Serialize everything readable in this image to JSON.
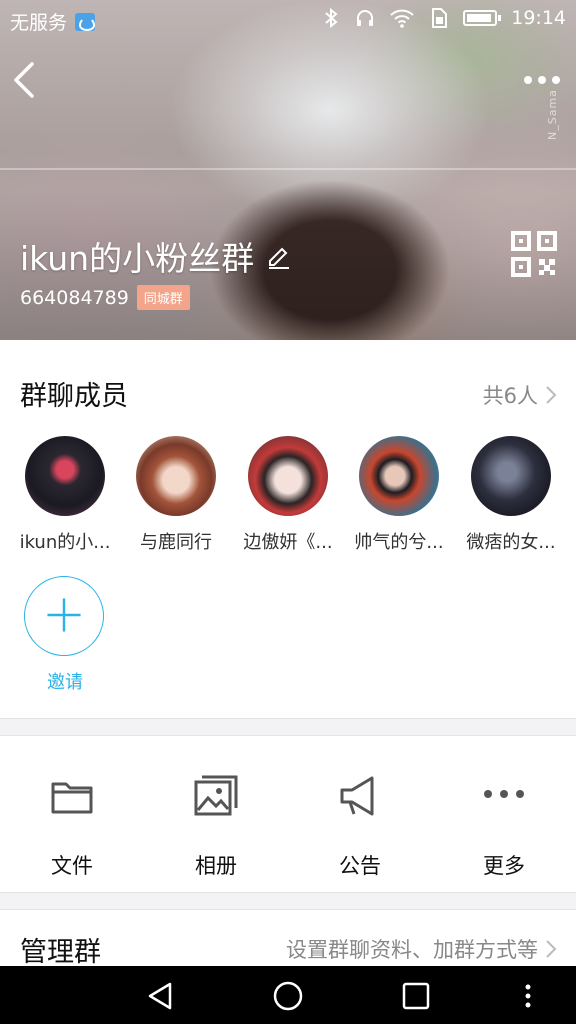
{
  "status_bar": {
    "carrier": "无服务",
    "time": "19:14",
    "icons": [
      "app-notification-icon",
      "bluetooth-icon",
      "headphones-icon",
      "wifi-icon",
      "sim-icon",
      "battery-icon"
    ]
  },
  "header": {
    "group_name": "ikun的小粉丝群",
    "group_id": "664084789",
    "badge": "同城群",
    "watermark": "N_Sama",
    "accent_color": "#2ab3e6"
  },
  "members": {
    "title": "群聊成员",
    "count_label": "共6人",
    "items": [
      {
        "name": "ikun的小...",
        "avatar_colors": [
          "#1a1a22",
          "#d8455c"
        ]
      },
      {
        "name": "与鹿同行",
        "avatar_colors": [
          "#e9cdb8",
          "#a2543a"
        ]
      },
      {
        "name": "边傲妍《...",
        "avatar_colors": [
          "#2a2424",
          "#f4e1dc"
        ]
      },
      {
        "name": "帅气的兮...",
        "avatar_colors": [
          "#3b6f8b",
          "#c7472f"
        ]
      },
      {
        "name": "微痞的女...",
        "avatar_colors": [
          "#2d2f3e",
          "#7b8196"
        ]
      }
    ],
    "invite_label": "邀请"
  },
  "tools": [
    {
      "label": "文件",
      "icon": "folder-icon"
    },
    {
      "label": "相册",
      "icon": "album-icon"
    },
    {
      "label": "公告",
      "icon": "megaphone-icon"
    },
    {
      "label": "更多",
      "icon": "more-dots-icon"
    }
  ],
  "manage": {
    "title": "管理群",
    "description": "设置群聊资料、加群方式等"
  }
}
